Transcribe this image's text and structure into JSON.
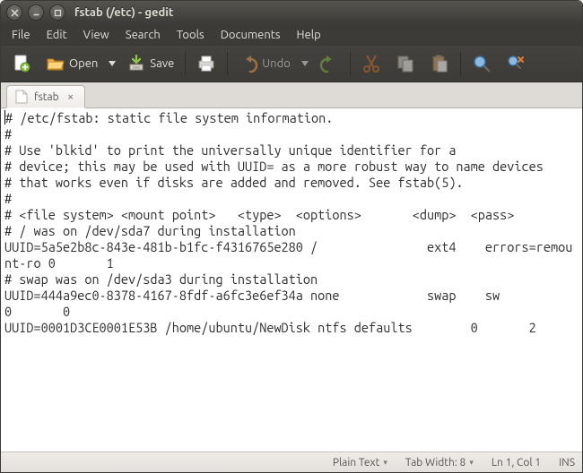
{
  "window": {
    "title": "fstab (/etc) - gedit"
  },
  "menu": {
    "file": "File",
    "edit": "Edit",
    "view": "View",
    "search": "Search",
    "tools": "Tools",
    "documents": "Documents",
    "help": "Help"
  },
  "toolbar": {
    "open": "Open",
    "save": "Save",
    "undo": "Undo"
  },
  "tab": {
    "label": "fstab"
  },
  "editor": {
    "content": "# /etc/fstab: static file system information.\n#\n# Use 'blkid' to print the universally unique identifier for a\n# device; this may be used with UUID= as a more robust way to name devices\n# that works even if disks are added and removed. See fstab(5).\n#\n# <file system> <mount point>   <type>  <options>       <dump>  <pass>\n# / was on /dev/sda7 during installation\nUUID=5a5e2b8c-843e-481b-b1fc-f4316765e280 /               ext4    errors=remount-ro 0       1\n# swap was on /dev/sda3 during installation\nUUID=444a9ec0-8378-4167-8fdf-a6fc3e6ef34a none            swap    sw              0       0\nUUID=0001D3CE0001E53B /home/ubuntu/NewDisk ntfs defaults        0       2"
  },
  "status": {
    "syntax": "Plain Text",
    "tabwidth": "Tab Width: 8",
    "position": "Ln 1, Col 1",
    "insert": "INS"
  }
}
